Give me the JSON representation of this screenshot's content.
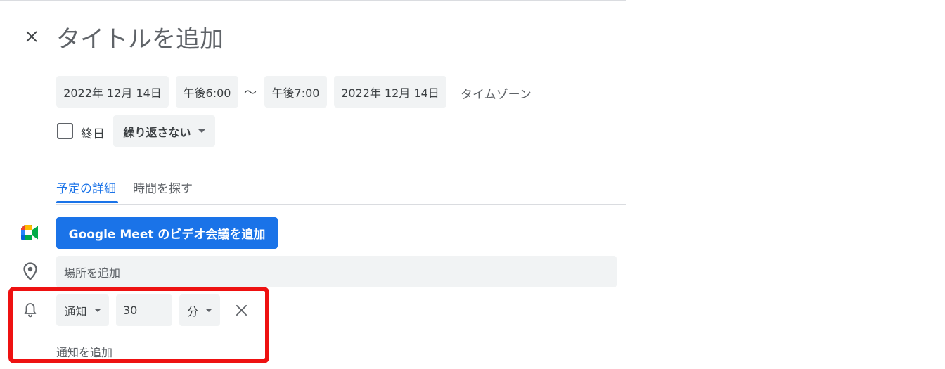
{
  "title": {
    "placeholder": "タイトルを追加"
  },
  "datetime": {
    "start_date": "2022年 12月 14日",
    "start_time": "午後6:00",
    "separator": "〜",
    "end_time": "午後7:00",
    "end_date": "2022年 12月 14日",
    "timezone_label": "タイムゾーン"
  },
  "allday": {
    "label": "終日",
    "checked": false
  },
  "repeat": {
    "selected": "繰り返さない"
  },
  "tabs": [
    {
      "label": "予定の詳細",
      "active": true
    },
    {
      "label": "時間を探す",
      "active": false
    }
  ],
  "meet": {
    "button_label": "Google Meet のビデオ会議を追加"
  },
  "location": {
    "placeholder": "場所を追加"
  },
  "notification": {
    "type": "通知",
    "value": "30",
    "unit": "分",
    "add_label": "通知を追加"
  },
  "icons": {
    "close": "close-icon",
    "meet": "google-meet-icon",
    "location": "location-pin-icon",
    "notification": "bell-icon",
    "remove": "close-icon"
  },
  "colors": {
    "accent": "#1a73e8",
    "field_background": "#f1f3f4",
    "highlight": "#ee1111"
  }
}
